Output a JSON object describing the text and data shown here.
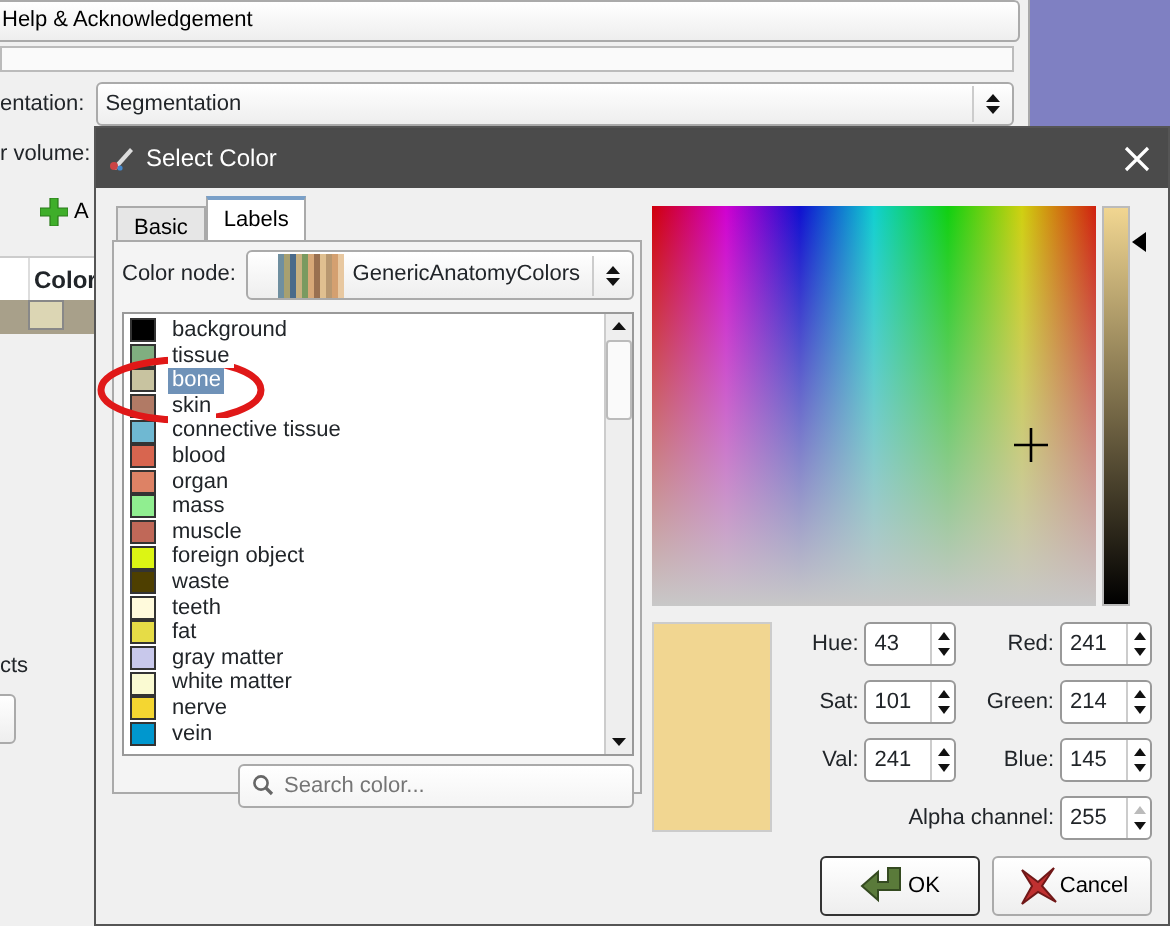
{
  "background_window": {
    "help_button": "Help & Acknowledgement",
    "representation_label": "entation:",
    "representation_value": "Segmentation",
    "volume_label": "r volume:",
    "add_button": "A",
    "table_header": "Color",
    "group_label": "cts"
  },
  "dialog": {
    "title": "Select Color",
    "tabs": [
      {
        "label": "Basic",
        "selected": false
      },
      {
        "label": "Labels",
        "selected": true
      }
    ],
    "color_node_label": "Color node:",
    "color_node_value": "GenericAnatomyColors",
    "labels": [
      {
        "name": "background",
        "color": "#000000",
        "selected": false
      },
      {
        "name": "tissue",
        "color": "#80ae80",
        "selected": false
      },
      {
        "name": "bone",
        "color": "#c8c3a0",
        "selected": true
      },
      {
        "name": "skin",
        "color": "#b17a65",
        "selected": false
      },
      {
        "name": "connective tissue",
        "color": "#6fb8d2",
        "selected": false
      },
      {
        "name": "blood",
        "color": "#d8654f",
        "selected": false
      },
      {
        "name": "organ",
        "color": "#dd8265",
        "selected": false
      },
      {
        "name": "mass",
        "color": "#90ee90",
        "selected": false
      },
      {
        "name": "muscle",
        "color": "#c06858",
        "selected": false
      },
      {
        "name": "foreign object",
        "color": "#dcf514",
        "selected": false
      },
      {
        "name": "waste",
        "color": "#4e3f00",
        "selected": false
      },
      {
        "name": "teeth",
        "color": "#fffadc",
        "selected": false
      },
      {
        "name": "fat",
        "color": "#e6dc46",
        "selected": false
      },
      {
        "name": "gray matter",
        "color": "#c8c8eb",
        "selected": false
      },
      {
        "name": "white matter",
        "color": "#fafad2",
        "selected": false
      },
      {
        "name": "nerve",
        "color": "#f4d631",
        "selected": false
      },
      {
        "name": "vein",
        "color": "#0097ce",
        "selected": false
      }
    ],
    "search_placeholder": "Search color...",
    "luminance": {
      "level": 0.95
    },
    "fields": [
      {
        "label": "Hue:",
        "value": "43"
      },
      {
        "label": "Red:",
        "value": "241"
      },
      {
        "label": "Sat:",
        "value": "101"
      },
      {
        "label": "Green:",
        "value": "214"
      },
      {
        "label": "Val:",
        "value": "241"
      },
      {
        "label": "Blue:",
        "value": "145"
      }
    ],
    "alpha": {
      "label": "Alpha channel:",
      "value": "255",
      "up_disabled": true
    },
    "buttons": [
      {
        "kind": "ok",
        "label": "OK"
      },
      {
        "kind": "cancel",
        "label": "Cancel"
      }
    ]
  }
}
